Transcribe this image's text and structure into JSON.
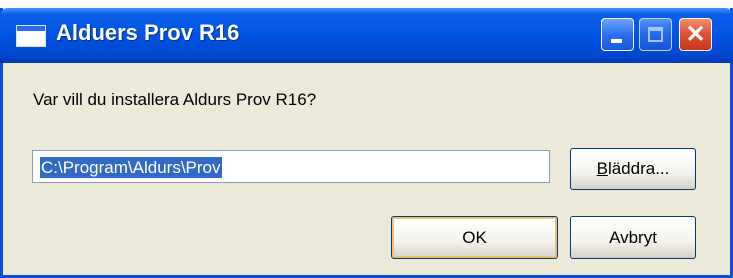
{
  "window": {
    "title": "Alduers Prov R16"
  },
  "dialog": {
    "prompt": "Var vill du installera Aldurs Prov R16?",
    "path_value": "C:\\Program\\Aldurs\\Prov",
    "browse_mnemonic": "B",
    "browse_rest": "läddra...",
    "ok_label": "OK",
    "cancel_label": "Avbryt"
  },
  "titlebar_buttons": {
    "close_glyph": "✕"
  },
  "icons": [
    "app-window-icon",
    "minimize-icon",
    "maximize-icon",
    "close-icon"
  ],
  "colors": {
    "titlebar": "#0055e5",
    "selection": "#316ac5",
    "dialog_bg": "#ece9d8",
    "close": "#e0553a"
  }
}
